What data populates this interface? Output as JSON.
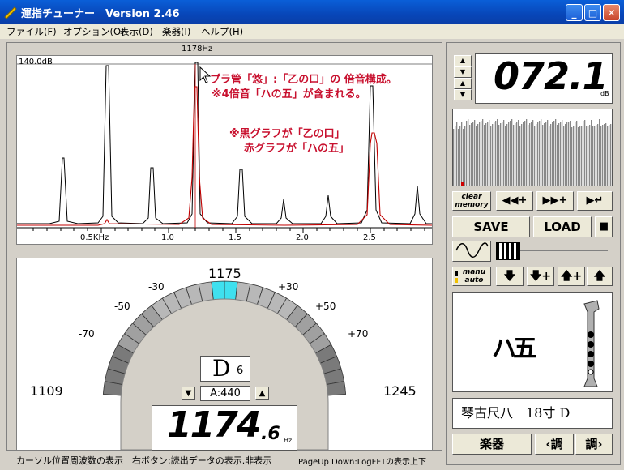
{
  "window": {
    "title": "運指チューナー　Version 2.46",
    "controls": {
      "minimize": "_",
      "maximize": "□",
      "close": "✕"
    }
  },
  "menu": {
    "items": [
      "ファイル(F)",
      "オプション(O)",
      "表示(D)",
      "楽器(I)",
      "ヘルプ(H)"
    ]
  },
  "spectrum": {
    "cursor_freq_label": "1178Hz",
    "db_label": "140.0dB",
    "x_ticks": [
      "0.5KHz",
      "1.0",
      "1.5",
      "2.0",
      "2.5"
    ],
    "annotation_line1": "プラ管「悠」:「乙の口」の 倍音構成。",
    "annotation_line2": "※4倍音「ハの五」が含まれる。",
    "annotation_line3": "※黒グラフが「乙の口」",
    "annotation_line4": "赤グラフが「ハの五」",
    "colors": {
      "black_graph": "#000000",
      "red_graph": "#c00000",
      "annotation": "#c8102e"
    }
  },
  "tuner": {
    "center_freq": "1175",
    "left_freq": "1109",
    "right_freq": "1245",
    "cent_labels": [
      "-70",
      "-50",
      "-30",
      "+30",
      "+50",
      "+70"
    ],
    "note": "D",
    "octave": "6",
    "a_ref": "A:440",
    "freq_main": "1174",
    "freq_decimal": ".6",
    "freq_unit": "Hz",
    "highlight_color": "#3fe0ef"
  },
  "right": {
    "db_value": "072.1",
    "db_unit": "dB",
    "clear_memory_line1": "clear",
    "clear_memory_line2": "memory",
    "save": "SAVE",
    "load": "LOAD",
    "manu": "manu",
    "auto": "auto",
    "fingering_text": "ハ五",
    "instrument": "琴古尺八　18寸 D",
    "instrument_button": "楽器",
    "tune_down": "‹調",
    "tune_up": "調›"
  },
  "status": {
    "text1": "カーソル位置周波数の表示　右ボタン:読出データの表示.非表示",
    "text2": "PageUp Down:LogFFTの表示上下"
  }
}
